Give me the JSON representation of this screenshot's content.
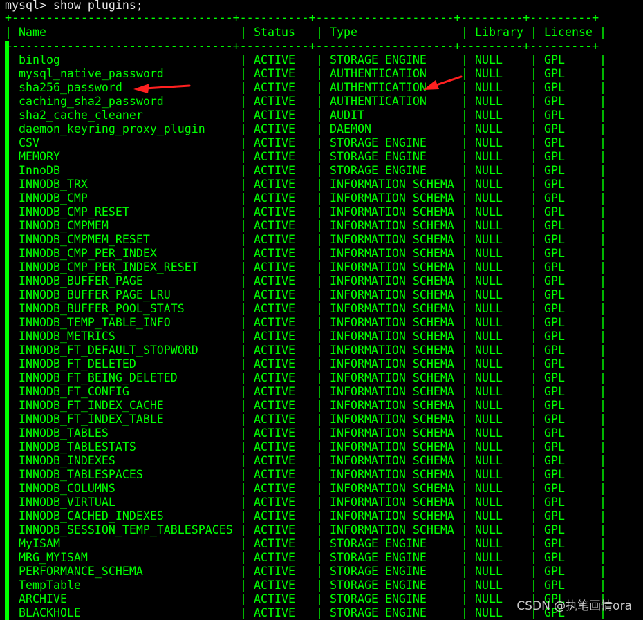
{
  "prompt": "mysql> show plugins;",
  "separator": "+--------------------------------+----------+--------------------+---------+---------+",
  "columns": [
    "Name",
    "Status",
    "Type",
    "Library",
    "License"
  ],
  "rows": [
    [
      "binlog",
      "ACTIVE",
      "STORAGE ENGINE",
      "NULL",
      "GPL"
    ],
    [
      "mysql_native_password",
      "ACTIVE",
      "AUTHENTICATION",
      "NULL",
      "GPL"
    ],
    [
      "sha256_password",
      "ACTIVE",
      "AUTHENTICATION",
      "NULL",
      "GPL"
    ],
    [
      "caching_sha2_password",
      "ACTIVE",
      "AUTHENTICATION",
      "NULL",
      "GPL"
    ],
    [
      "sha2_cache_cleaner",
      "ACTIVE",
      "AUDIT",
      "NULL",
      "GPL"
    ],
    [
      "daemon_keyring_proxy_plugin",
      "ACTIVE",
      "DAEMON",
      "NULL",
      "GPL"
    ],
    [
      "CSV",
      "ACTIVE",
      "STORAGE ENGINE",
      "NULL",
      "GPL"
    ],
    [
      "MEMORY",
      "ACTIVE",
      "STORAGE ENGINE",
      "NULL",
      "GPL"
    ],
    [
      "InnoDB",
      "ACTIVE",
      "STORAGE ENGINE",
      "NULL",
      "GPL"
    ],
    [
      "INNODB_TRX",
      "ACTIVE",
      "INFORMATION SCHEMA",
      "NULL",
      "GPL"
    ],
    [
      "INNODB_CMP",
      "ACTIVE",
      "INFORMATION SCHEMA",
      "NULL",
      "GPL"
    ],
    [
      "INNODB_CMP_RESET",
      "ACTIVE",
      "INFORMATION SCHEMA",
      "NULL",
      "GPL"
    ],
    [
      "INNODB_CMPMEM",
      "ACTIVE",
      "INFORMATION SCHEMA",
      "NULL",
      "GPL"
    ],
    [
      "INNODB_CMPMEM_RESET",
      "ACTIVE",
      "INFORMATION SCHEMA",
      "NULL",
      "GPL"
    ],
    [
      "INNODB_CMP_PER_INDEX",
      "ACTIVE",
      "INFORMATION SCHEMA",
      "NULL",
      "GPL"
    ],
    [
      "INNODB_CMP_PER_INDEX_RESET",
      "ACTIVE",
      "INFORMATION SCHEMA",
      "NULL",
      "GPL"
    ],
    [
      "INNODB_BUFFER_PAGE",
      "ACTIVE",
      "INFORMATION SCHEMA",
      "NULL",
      "GPL"
    ],
    [
      "INNODB_BUFFER_PAGE_LRU",
      "ACTIVE",
      "INFORMATION SCHEMA",
      "NULL",
      "GPL"
    ],
    [
      "INNODB_BUFFER_POOL_STATS",
      "ACTIVE",
      "INFORMATION SCHEMA",
      "NULL",
      "GPL"
    ],
    [
      "INNODB_TEMP_TABLE_INFO",
      "ACTIVE",
      "INFORMATION SCHEMA",
      "NULL",
      "GPL"
    ],
    [
      "INNODB_METRICS",
      "ACTIVE",
      "INFORMATION SCHEMA",
      "NULL",
      "GPL"
    ],
    [
      "INNODB_FT_DEFAULT_STOPWORD",
      "ACTIVE",
      "INFORMATION SCHEMA",
      "NULL",
      "GPL"
    ],
    [
      "INNODB_FT_DELETED",
      "ACTIVE",
      "INFORMATION SCHEMA",
      "NULL",
      "GPL"
    ],
    [
      "INNODB_FT_BEING_DELETED",
      "ACTIVE",
      "INFORMATION SCHEMA",
      "NULL",
      "GPL"
    ],
    [
      "INNODB_FT_CONFIG",
      "ACTIVE",
      "INFORMATION SCHEMA",
      "NULL",
      "GPL"
    ],
    [
      "INNODB_FT_INDEX_CACHE",
      "ACTIVE",
      "INFORMATION SCHEMA",
      "NULL",
      "GPL"
    ],
    [
      "INNODB_FT_INDEX_TABLE",
      "ACTIVE",
      "INFORMATION SCHEMA",
      "NULL",
      "GPL"
    ],
    [
      "INNODB_TABLES",
      "ACTIVE",
      "INFORMATION SCHEMA",
      "NULL",
      "GPL"
    ],
    [
      "INNODB_TABLESTATS",
      "ACTIVE",
      "INFORMATION SCHEMA",
      "NULL",
      "GPL"
    ],
    [
      "INNODB_INDEXES",
      "ACTIVE",
      "INFORMATION SCHEMA",
      "NULL",
      "GPL"
    ],
    [
      "INNODB_TABLESPACES",
      "ACTIVE",
      "INFORMATION SCHEMA",
      "NULL",
      "GPL"
    ],
    [
      "INNODB_COLUMNS",
      "ACTIVE",
      "INFORMATION SCHEMA",
      "NULL",
      "GPL"
    ],
    [
      "INNODB_VIRTUAL",
      "ACTIVE",
      "INFORMATION SCHEMA",
      "NULL",
      "GPL"
    ],
    [
      "INNODB_CACHED_INDEXES",
      "ACTIVE",
      "INFORMATION SCHEMA",
      "NULL",
      "GPL"
    ],
    [
      "INNODB_SESSION_TEMP_TABLESPACES",
      "ACTIVE",
      "INFORMATION SCHEMA",
      "NULL",
      "GPL"
    ],
    [
      "MyISAM",
      "ACTIVE",
      "STORAGE ENGINE",
      "NULL",
      "GPL"
    ],
    [
      "MRG_MYISAM",
      "ACTIVE",
      "STORAGE ENGINE",
      "NULL",
      "GPL"
    ],
    [
      "PERFORMANCE_SCHEMA",
      "ACTIVE",
      "STORAGE ENGINE",
      "NULL",
      "GPL"
    ],
    [
      "TempTable",
      "ACTIVE",
      "STORAGE ENGINE",
      "NULL",
      "GPL"
    ],
    [
      "ARCHIVE",
      "ACTIVE",
      "STORAGE ENGINE",
      "NULL",
      "GPL"
    ],
    [
      "BLACKHOLE",
      "ACTIVE",
      "STORAGE ENGINE",
      "NULL",
      "GPL"
    ]
  ],
  "watermark": "CSDN @执笔画情ora",
  "colors": {
    "terminal_bg": "#000000",
    "terminal_text": "#00ff00",
    "prompt_text": "#e6e6e6",
    "annotation_arrow": "#ff2020",
    "watermark": "#c8c8c8"
  },
  "icons": [
    "red-arrow-icon",
    "red-arrow-icon"
  ]
}
